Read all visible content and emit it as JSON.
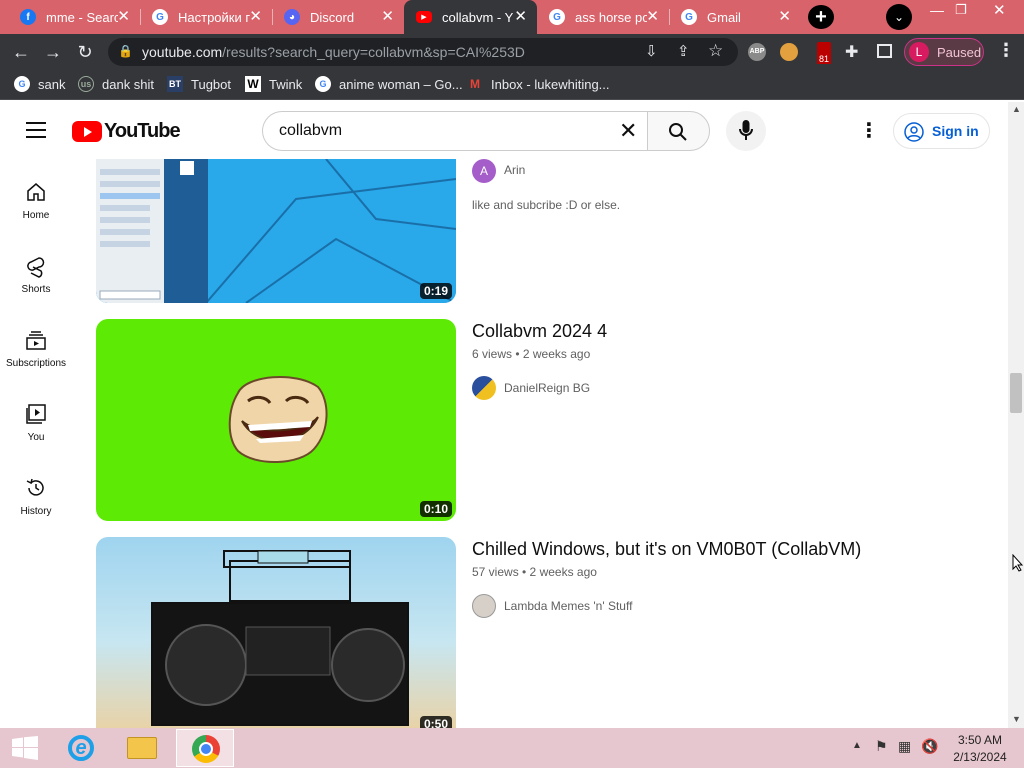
{
  "tabs": [
    {
      "title": "mme - Searc",
      "favicon": "facebook-icon"
    },
    {
      "title": "Настройки г",
      "favicon": "google-icon"
    },
    {
      "title": "Discord",
      "favicon": "discord-icon"
    },
    {
      "title": "collabvm - Y",
      "favicon": "youtube-icon"
    },
    {
      "title": "ass horse po",
      "favicon": "google-icon"
    },
    {
      "title": "Gmail",
      "favicon": "google-icon"
    }
  ],
  "url": {
    "host": "youtube.com",
    "path": "/results?search_query=collabvm&sp=CAI%253D"
  },
  "profile": {
    "initial": "L",
    "status": "Paused"
  },
  "extensions": {
    "badge": "81"
  },
  "bookmarks": [
    "sank",
    "dank shit",
    "Tugbot",
    "Twink",
    "anime woman – Go...",
    "Inbox - lukewhiting..."
  ],
  "youtube": {
    "logo": "YouTube",
    "search_value": "collabvm",
    "signin": "Sign in",
    "nav": [
      "Home",
      "Shorts",
      "Subscriptions",
      "You",
      "History"
    ]
  },
  "videos": [
    {
      "title": "",
      "meta": "",
      "channel": "Arin",
      "description": "like and subcribe :D or else.",
      "duration": "0:19",
      "avatar_letter": "A"
    },
    {
      "title": "Collabvm 2024 4",
      "meta": "6 views • 2 weeks ago",
      "channel": "DanielReign BG",
      "description": "",
      "duration": "0:10"
    },
    {
      "title": "Chilled Windows, but it's on VM0B0T (CollabVM)",
      "meta": "57 views • 2 weeks ago",
      "channel": "Lambda Memes 'n' Stuff",
      "description": "",
      "duration": "0:50"
    }
  ],
  "taskbar": {
    "time": "3:50 AM",
    "date": "2/13/2024"
  },
  "colors": {
    "tabstrip": "#d8636b",
    "chrome_dark": "#35363a",
    "youtube_red": "#ff0000",
    "signin_blue": "#065fd4",
    "green_screen": "#5dea04"
  }
}
